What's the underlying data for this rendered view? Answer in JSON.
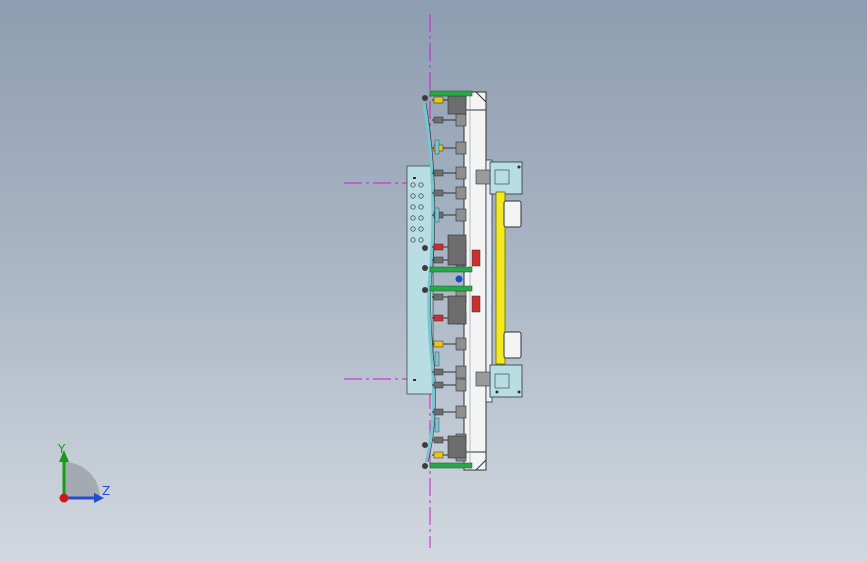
{
  "viewport": {
    "background_top": "#8e9db1",
    "background_bottom": "#d2d8e0",
    "centerline_color": "#d21ad2"
  },
  "triad": {
    "y_label": "Y",
    "z_label": "Z",
    "y_color": "#1a9a1a",
    "z_color": "#1f4fd0",
    "origin_color": "#d01818"
  },
  "model": {
    "frame_color": "#f4f4f4",
    "panel_color": "#b8dde3",
    "rod_color": "#f2ea1e",
    "clamp_green": "#29a84a",
    "clamp_yellow": "#e8c51c",
    "clamp_red": "#c93030",
    "clamp_gray": "#6d6d6d",
    "sheet_color": "#78c7d0"
  }
}
